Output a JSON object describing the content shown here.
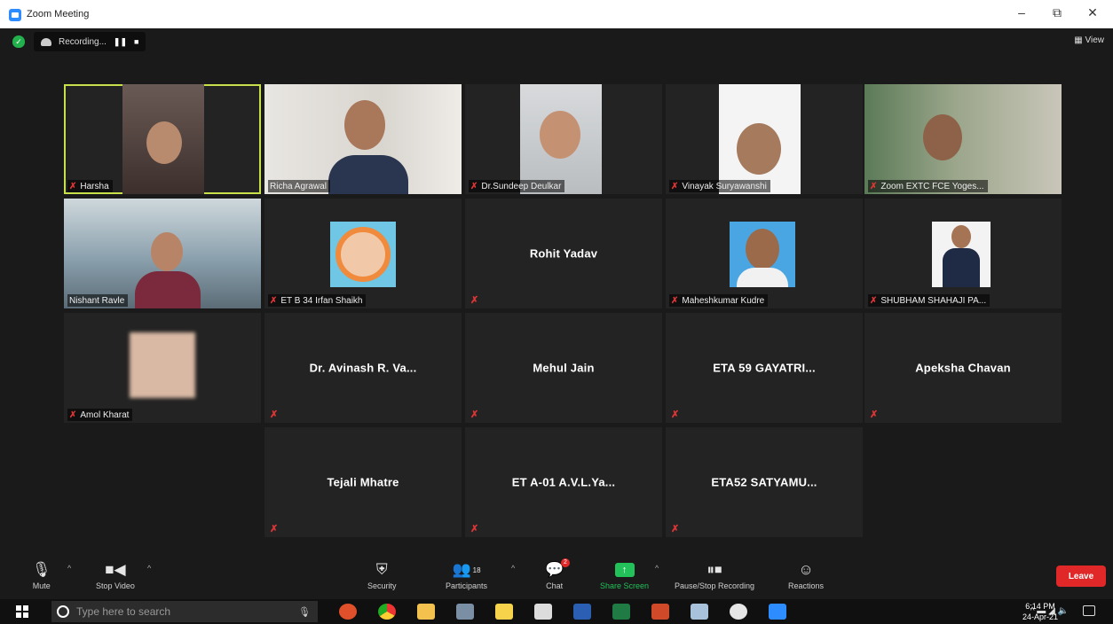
{
  "window": {
    "title": "Zoom Meeting",
    "controls": [
      "–",
      "⧉",
      "✕"
    ]
  },
  "recording": {
    "label": "Recording...",
    "pause": "❚❚",
    "stop": "■"
  },
  "view_label": "▦ View",
  "tiles": {
    "harsha": "Harsha",
    "richa": "Richa Agrawal",
    "sundeep": "Dr.Sundeep Deulkar",
    "vinayak": "Vinayak Suryawanshi",
    "yogesh": "Zoom EXTC FCE Yoges...",
    "nishant": "Nishant Ravle",
    "irfan": "ET B 34 Irfan Shaikh",
    "rohit": "Rohit Yadav",
    "mahesh": "Maheshkumar Kudre",
    "shubham": "SHUBHAM SHAHAJI PA...",
    "amol": "Amol Kharat",
    "avinash": "Dr. Avinash R. Va...",
    "mehul": "Mehul Jain",
    "gayatri": "ETA 59 GAYATRI...",
    "apeksha": "Apeksha Chavan",
    "tejali": "Tejali Mhatre",
    "avly": "ET A-01 A.V.L.Ya...",
    "satyamu": "ETA52 SATYAMU..."
  },
  "toolbar": {
    "mute": "Mute",
    "stop_video": "Stop Video",
    "security": "Security",
    "participants": "Participants",
    "participants_count": "18",
    "chat": "Chat",
    "chat_badge": "2",
    "share_screen": "Share Screen",
    "pause_stop_recording": "Pause/Stop Recording",
    "reactions": "Reactions",
    "leave": "Leave"
  },
  "taskbar": {
    "search_placeholder": "Type here to search",
    "time": "6:14 PM",
    "date": "24-Apr-21"
  },
  "colors": {
    "active_speaker": "#c8e04a",
    "leave": "#e02828",
    "share": "#23c15a",
    "muted": "#e03535"
  }
}
